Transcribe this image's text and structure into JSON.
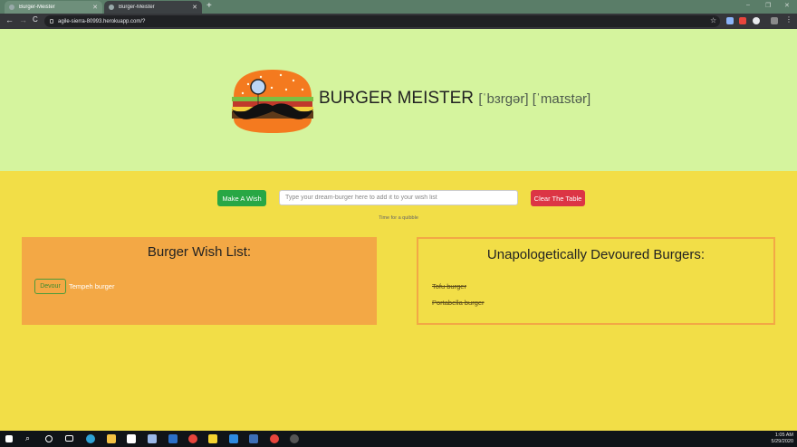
{
  "browser": {
    "tabs": [
      {
        "label": "Burger-Meister",
        "active": true
      },
      {
        "label": "Burger-Meister",
        "active": false
      }
    ],
    "new_tab": "+",
    "back": "←",
    "forward": "→",
    "reload": "C",
    "url": "agile-sierra-80993.herokuapp.com/?",
    "window_controls": {
      "minimize": "–",
      "restore": "❐",
      "close": "✕"
    }
  },
  "hero": {
    "title": "BURGER MEISTER",
    "phonetic": "[ˈbɜrɡər] [ˈmaɪstər]"
  },
  "controls": {
    "wish_button": "Make A Wish",
    "input_placeholder": "Type your dream-burger here to add it to your wish list",
    "clear_button": "Clear The Table",
    "quip": "Time for a quibble"
  },
  "wish_list": {
    "title": "Burger Wish List:",
    "items": [
      {
        "name": "Tempeh burger",
        "action": "Devour"
      }
    ]
  },
  "devoured": {
    "title": "Unapologetically Devoured Burgers:",
    "items": [
      "Tofu burger",
      "Portabella burger"
    ]
  },
  "taskbar": {
    "time": "1:05 AM",
    "date": "5/29/2020"
  },
  "colors": {
    "hero_bg": "#d5f49e",
    "page_bg": "#f2de47",
    "panel": "#f3a845",
    "wish_btn": "#28a745",
    "clear_btn": "#dc3545"
  }
}
